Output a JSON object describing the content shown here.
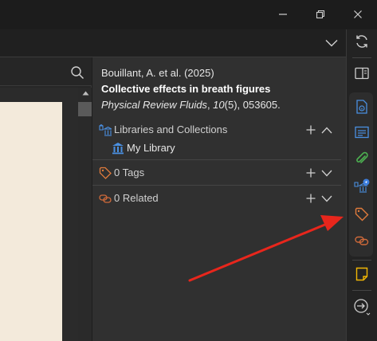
{
  "window": {
    "icons": [
      "minimize-icon",
      "restore-icon",
      "close-icon"
    ]
  },
  "toolbar": {
    "icons": [
      "chevron-down-icon",
      "sync-icon"
    ]
  },
  "reader": {
    "icons": [
      "search-icon"
    ]
  },
  "item": {
    "authors": "Bouillant, A. et al. (2025)",
    "title": "Collective effects in breath figures",
    "journal": "Physical Review Fluids",
    "volume": "10",
    "issue_pages": "(5), 053605."
  },
  "sections": {
    "libraries": {
      "label": "Libraries and Collections",
      "items": [
        {
          "label": "My Library"
        }
      ]
    },
    "tags": {
      "label": "0 Tags"
    },
    "related": {
      "label": "0 Related"
    }
  },
  "sidenav": {
    "icons": [
      "toggle-pane-icon",
      "info-icon",
      "abstract-icon",
      "attachments-icon",
      "libraries-collections-icon",
      "tags-icon",
      "related-icon",
      "notes-icon",
      "locate-icon"
    ]
  },
  "colors": {
    "accent_blue": "#4a90e2",
    "attachment_green": "#4caf50",
    "tag_orange": "#e07b3c",
    "related_orange": "#d06a3a",
    "note_yellow": "#f2b705",
    "annotation_red": "#e8261c"
  }
}
